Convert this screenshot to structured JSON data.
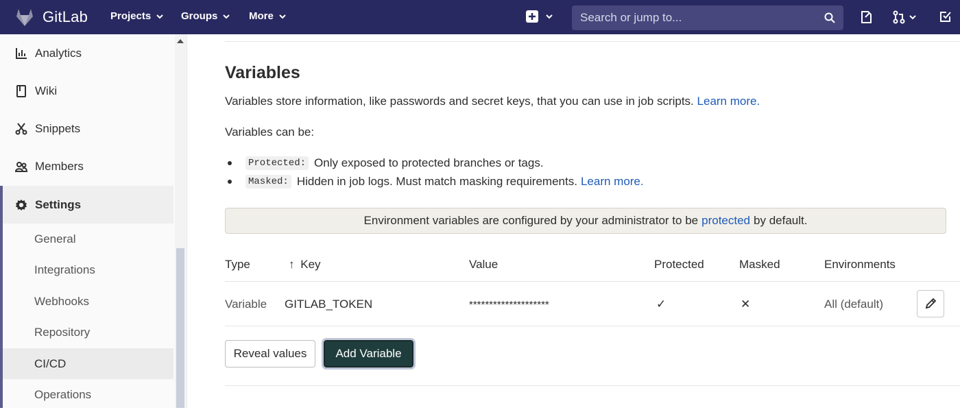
{
  "navbar": {
    "brand": "GitLab",
    "menus": [
      "Projects",
      "Groups",
      "More"
    ],
    "search_placeholder": "Search or jump to..."
  },
  "sidebar": {
    "items": [
      {
        "label": "Analytics",
        "icon": "analytics-icon"
      },
      {
        "label": "Wiki",
        "icon": "book-icon"
      },
      {
        "label": "Snippets",
        "icon": "scissors-icon"
      },
      {
        "label": "Members",
        "icon": "users-icon"
      },
      {
        "label": "Settings",
        "icon": "gear-icon"
      }
    ],
    "sub_items": [
      "General",
      "Integrations",
      "Webhooks",
      "Repository",
      "CI/CD",
      "Operations"
    ],
    "active_sub_item": "CI/CD"
  },
  "variables": {
    "title": "Variables",
    "intro": "Variables store information, like passwords and secret keys, that you can use in job scripts.",
    "learn_more": "Learn more.",
    "can_be": "Variables can be:",
    "bullets": [
      {
        "code": "Protected:",
        "text": "Only exposed to protected branches or tags.",
        "link": ""
      },
      {
        "code": "Masked:",
        "text": "Hidden in job logs. Must match masking requirements.",
        "link": "Learn more."
      }
    ],
    "notice_prefix": "Environment variables are configured by your administrator to be",
    "notice_link": "protected",
    "notice_suffix": "by default.",
    "columns": [
      "Type",
      "Key",
      "Value",
      "Protected",
      "Masked",
      "Environments"
    ],
    "sort_indicator": "↑",
    "rows": [
      {
        "type": "Variable",
        "key": "GITLAB_TOKEN",
        "value": "********************",
        "protected": "✓",
        "masked": "✕",
        "environments": "All (default)"
      }
    ],
    "reveal_button": "Reveal values",
    "add_button": "Add Variable"
  },
  "colors": {
    "navbar": "#292961",
    "link": "#1f5bb8",
    "add_button": "#1f3d3d",
    "sidebar_accent": "#5b5b8d"
  }
}
